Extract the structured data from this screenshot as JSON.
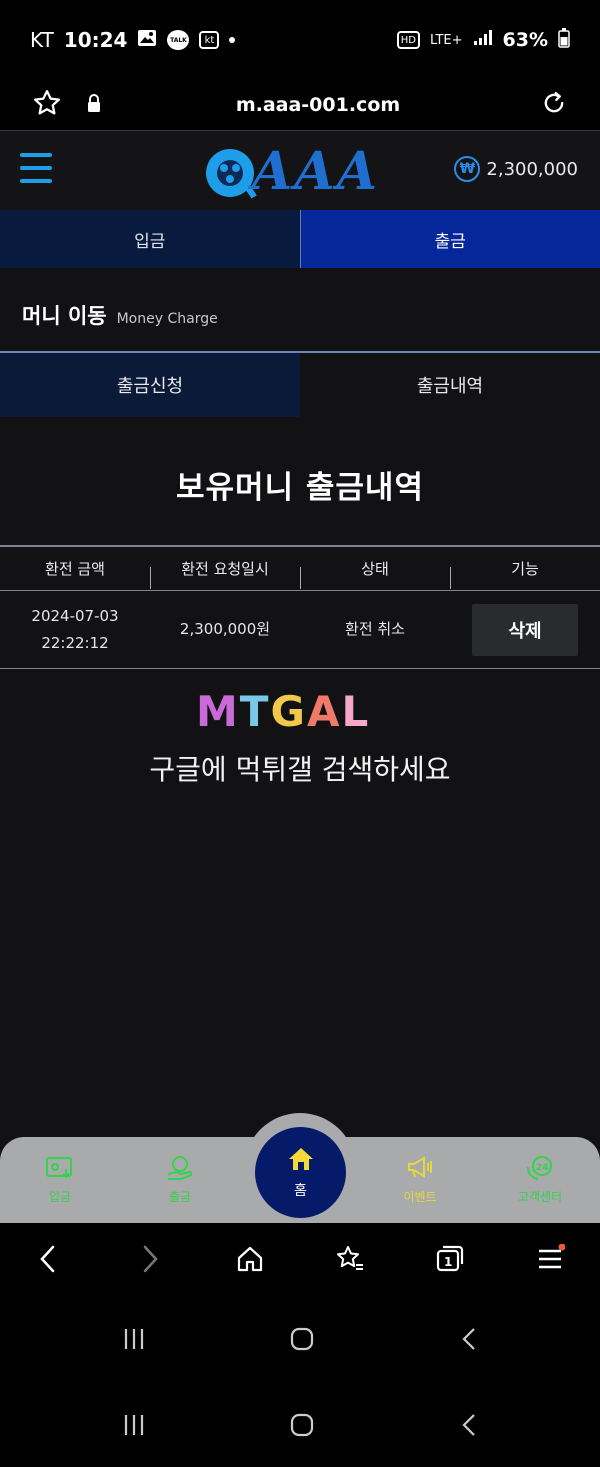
{
  "status_bar": {
    "carrier": "KT",
    "time": "10:24",
    "talk_badge": "TALK",
    "kt_badge": "kt",
    "hd_badge": "HD",
    "network": "LTE+",
    "battery": "63%"
  },
  "url_bar": {
    "url": "m.aaa-001.com"
  },
  "header": {
    "logo_text": "AAA",
    "balance": "2,300,000",
    "currency_symbol": "₩"
  },
  "main_tabs": [
    {
      "label": "입금",
      "active": false
    },
    {
      "label": "출금",
      "active": true
    }
  ],
  "section": {
    "title_ko": "머니 이동",
    "title_en": "Money Charge"
  },
  "sub_tabs": [
    {
      "label": "출금신청",
      "active": true
    },
    {
      "label": "출금내역",
      "active": false
    }
  ],
  "heading": "보유머니 출금내역",
  "table": {
    "columns": [
      "환전 금액",
      "환전 요청일시",
      "상태",
      "기능"
    ],
    "rows": [
      {
        "date": "2024-07-03",
        "time": "22:22:12",
        "amount": "2,300,000원",
        "status": "환전 취소",
        "action": "삭제"
      }
    ]
  },
  "watermark": {
    "logo_text": "MTGAL",
    "text": "구글에 먹튀갤 검색하세요"
  },
  "bottom_nav": {
    "items": [
      {
        "label": "입금",
        "icon": "deposit-icon"
      },
      {
        "label": "출금",
        "icon": "withdraw-icon"
      },
      {
        "label": "홈",
        "icon": "home-icon"
      },
      {
        "label": "이벤트",
        "icon": "megaphone-icon"
      },
      {
        "label": "고객센터",
        "icon": "support-24-icon"
      }
    ]
  },
  "colors": {
    "accent_blue": "#05279a",
    "logo_blue": "#1e9ee8",
    "nav_green": "#33d34b",
    "nav_yellow": "#e5d83a",
    "home_circle": "#061a6a"
  }
}
